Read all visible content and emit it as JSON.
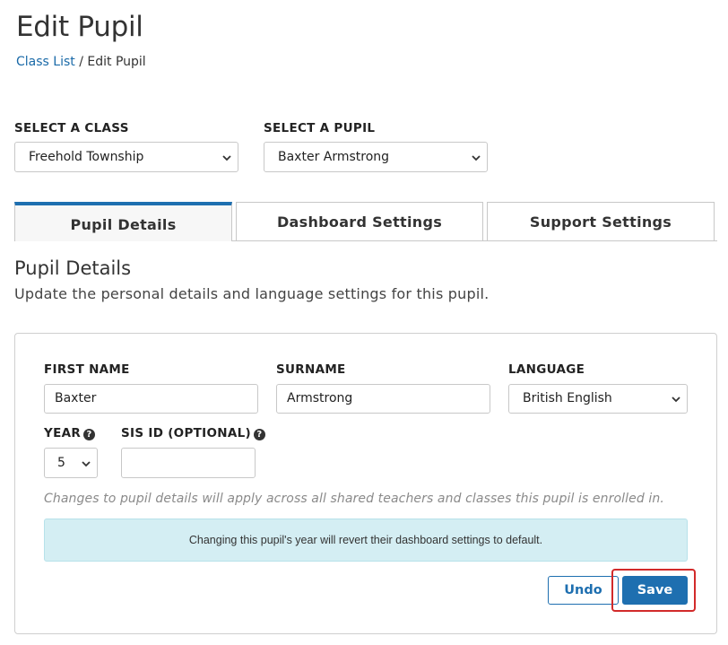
{
  "page": {
    "title": "Edit Pupil"
  },
  "breadcrumb": {
    "link": "Class List",
    "separator": "/",
    "current": "Edit Pupil"
  },
  "selectors": {
    "class_label": "SELECT A CLASS",
    "class_value": "Freehold Township",
    "pupil_label": "SELECT A PUPIL",
    "pupil_value": "Baxter Armstrong"
  },
  "tabs": [
    {
      "label": "Pupil Details",
      "active": true
    },
    {
      "label": "Dashboard Settings",
      "active": false
    },
    {
      "label": "Support Settings",
      "active": false
    }
  ],
  "section": {
    "title": "Pupil Details",
    "subtitle": "Update the personal details and language settings for this pupil."
  },
  "form": {
    "first_name_label": "FIRST NAME",
    "first_name_value": "Baxter",
    "surname_label": "SURNAME",
    "surname_value": "Armstrong",
    "language_label": "LANGUAGE",
    "language_value": "British English",
    "year_label": "YEAR",
    "year_value": "5",
    "sis_label": "SIS ID (OPTIONAL)",
    "sis_value": "",
    "help_glyph": "?"
  },
  "note": "Changes to pupil details will apply across all shared teachers and classes this pupil is enrolled in.",
  "alert": "Changing this pupil's year will revert their dashboard settings to default.",
  "buttons": {
    "undo": "Undo",
    "save": "Save"
  },
  "colors": {
    "accent": "#1e6fb0",
    "link": "#1a6aa8",
    "alert_bg": "#d4eef3",
    "highlight": "#d22a2a"
  }
}
